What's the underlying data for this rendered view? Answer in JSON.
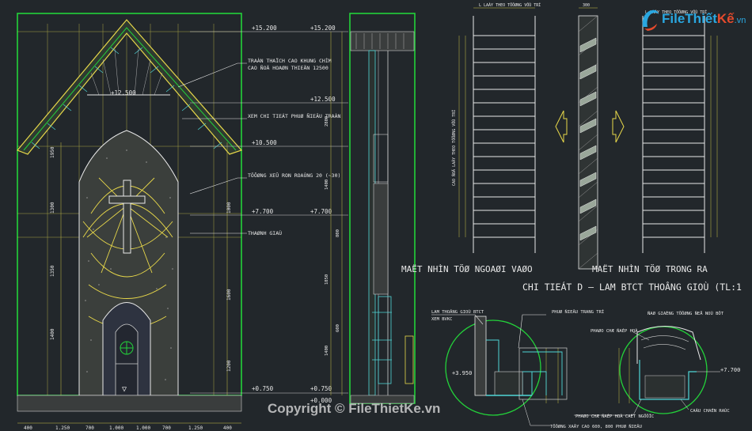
{
  "logo": {
    "brand": "File",
    "mid": "Thiết",
    "accent": "Kế",
    "tld": ".vn"
  },
  "watermark": "Copyright © FileThietKe.vn",
  "elevation_marks": [
    "+15.200",
    "+15.200",
    "+12.500",
    "+12.500",
    "+10.500",
    "+7.700",
    "+7.700",
    "+0.750",
    "+0.750",
    "+0.000"
  ],
  "annotations": {
    "ceiling": "TRAÀN THAÏCH CAO KHUNG CHÌM",
    "ceiling2": "CAO ÑOÄ HOAØN THIEÄN 12500",
    "roof_detail": "XEM CHI TIEÁT PHUØ ÑIEÂU TRAÀN",
    "wall_relief": "TÖÔØNG XEÛ RON ROAÙNG 20 (~30)",
    "cornice": "THAØNH GIAÙ"
  },
  "louver": {
    "top_left": "L LAÁY THEO TÖÔØNG VÔÙ TRÍ",
    "top_right": "L LAÁY THEO TÖÔØNG VÔÙ TRÍ",
    "side_note": "CAO ÑOÄ LAÁY THEO TÖÔØNG VÔÙ TRÍ",
    "dim_top": "300",
    "view_out": "MAËT NHÌN TÖØ NGOAØI VAØO",
    "view_in": "MAËT NHÌN TÖØ TRONG RA",
    "detail_title": "CHI TIEÁT D – LAM BTCT THOÂNG GIOÙ  (TL:1"
  },
  "details": {
    "left1": "LAM THOÂNG GIOÙ BTCT",
    "left2": "XEM BVKC",
    "mid1": "PHUØ ÑIEÂU TRANG TRÍ",
    "right1": "ÑAØ GIAÈNG TÖÔØNG ÑEÅ NOÙ BÔT",
    "right2": "PHAØO CHÆ ÑAÉP HOÀ",
    "bottom_mid": "PHAØO CHÆ ÑAÉP HOÀ CAÉT NGÖÔÏC",
    "bottom_right": "CAÀU CHAÉN RAÙC",
    "bottom_wall": "TÖÔØNG XAÂY CAO 600, 800 PHUØ ÑIEÂU",
    "level_left": "+3.950",
    "level_right": "+7.700"
  },
  "bottom_dims": [
    "400",
    "1.250",
    "700",
    "1.000",
    "1.000",
    "700",
    "1.250",
    "400"
  ],
  "colors": {
    "background": "#22272b",
    "green": "#23d23a",
    "yellow": "#e8d84a",
    "cyan": "#4fd6d6",
    "white": "#e8e8e8",
    "magenta": "#d04cd0"
  }
}
